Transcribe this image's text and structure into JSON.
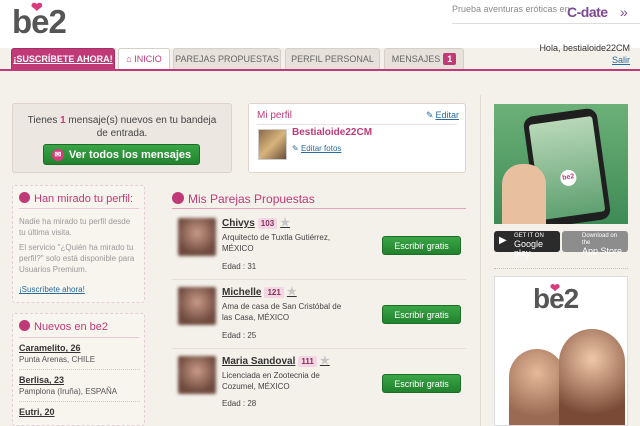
{
  "header": {
    "logo_text": "be2",
    "promo": "Prueba aventuras eróticas en",
    "cdate": "C-date",
    "cdate_chevron": "»"
  },
  "nav": {
    "subscribe": "¡Suscríbete ahora!",
    "home": "Inicio",
    "parejas": "Parejas propuestas",
    "perfil": "Perfil personal",
    "mensajes": "Mensajes",
    "mensajes_count": "1"
  },
  "user": {
    "greeting": "Hola, bestialoide22CM",
    "logout": "Salir"
  },
  "messages_box": {
    "text_prefix": "Tienes ",
    "count": "1",
    "text_suffix": " mensaje(s) nuevos en tu bandeja de entrada.",
    "button": "Ver todos los mensajes"
  },
  "profile_box": {
    "title": "Mi perfil",
    "edit": "Editar",
    "username": "Bestialoide22CM",
    "edit_photos": "Editar fotos"
  },
  "viewed": {
    "title": "Han mirado tu perfil:",
    "text1": "Nadie ha mirado tu perfil desde tu última visita.",
    "text2": "El servicio \"¿Quién ha mirado tu perfil?\" solo está disponible para Usuarios Premium.",
    "link": "¡Suscríbete ahora!"
  },
  "newbies": {
    "title": "Nuevos en be2",
    "items": [
      {
        "name": "Caramelito, 26",
        "location": "Punta Arenas, CHILE"
      },
      {
        "name": "Berlisa, 23",
        "location": "Pamplona (Iruña), ESPAÑA"
      },
      {
        "name": "Eutri, 20",
        "location": ""
      }
    ]
  },
  "matches": {
    "title": "Mis Parejas Propuestas",
    "button_label": "Escribir gratis",
    "items": [
      {
        "name": "Chivys",
        "score": "103",
        "desc": "Arquitecto de Tuxtla Gutiérrez, MÉXICO",
        "age": "Edad : 31"
      },
      {
        "name": "Michelle",
        "score": "121",
        "desc": "Ama de casa de San Cristóbal de las Casa, MÉXICO",
        "age": "Edad : 25"
      },
      {
        "name": "Maria Sandoval",
        "score": "111",
        "desc": "Licenciada en Zootecnia de Cozumel, MÉXICO",
        "age": "Edad : 28"
      }
    ]
  },
  "right_col": {
    "google_small": "GET IT ON",
    "google": "Google play",
    "apple_small": "Download on the",
    "apple": "App Store",
    "ad_logo": "be2",
    "phone_logo": "be2"
  },
  "colors": {
    "accent": "#c03a77",
    "button_green": "#2c9a3a",
    "link": "#2a6a9c"
  }
}
